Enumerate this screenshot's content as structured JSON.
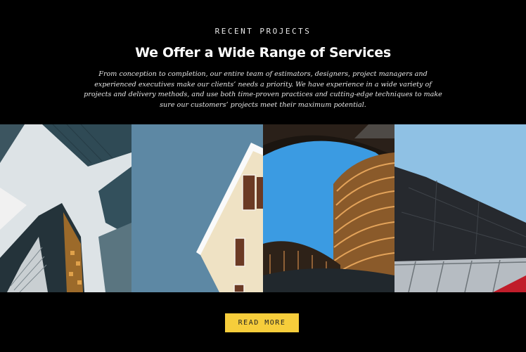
{
  "section": {
    "eyebrow": "RECENT PROJECTS",
    "title": "We Offer a Wide Range of Services",
    "description": "From conception to completion, our entire team of estimators, designers, project managers and experienced executives make our clients’ needs a priority. We have experience in a wide variety of projects and delivery methods, and use both time-proven practices and cutting-edge techniques to make sure our customers’ projects meet their maximum potential."
  },
  "gallery": [
    {
      "icon": "skyscrapers-photo"
    },
    {
      "icon": "house-facade-photo"
    },
    {
      "icon": "curved-tower-photo"
    },
    {
      "icon": "modern-building-photo"
    }
  ],
  "cta": {
    "label": "READ MORE"
  },
  "colors": {
    "background": "#000000",
    "accent": "#f6cd3b",
    "text": "#ffffff"
  }
}
